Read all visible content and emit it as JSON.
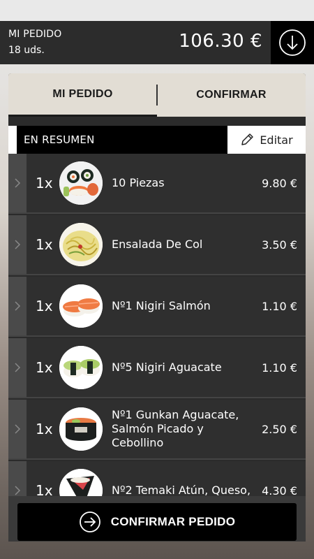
{
  "header": {
    "title": "MI PEDIDO",
    "count": "18 uds.",
    "total": "106.30 €",
    "download_icon": "arrow-down-circle-icon"
  },
  "tabs": [
    {
      "label": "MI PEDIDO",
      "active": true
    },
    {
      "label": "CONFIRMAR",
      "active": false
    }
  ],
  "summary": {
    "label": "EN RESUMEN",
    "edit_label": "Editar",
    "edit_icon": "pencil-icon"
  },
  "items": [
    {
      "qty": "1x",
      "name": "10 Piezas",
      "price": "9.80 €",
      "image": "sushi-platter"
    },
    {
      "qty": "1x",
      "name": "Ensalada De Col",
      "price": "3.50 €",
      "image": "cabbage-salad"
    },
    {
      "qty": "1x",
      "name": "Nº1 Nigiri Salmón",
      "price": "1.10 €",
      "image": "salmon-nigiri"
    },
    {
      "qty": "1x",
      "name": "Nº5 Nigiri Aguacate",
      "price": "1.10 €",
      "image": "avocado-nigiri"
    },
    {
      "qty": "1x",
      "name": "Nº1 Gunkan Aguacate, Salmón Picado y Cebollino",
      "price": "2.50 €",
      "image": "gunkan"
    },
    {
      "qty": "1x",
      "name": "Nº2 Temaki Atún, Queso,",
      "price": "4.30 €",
      "image": "temaki"
    }
  ],
  "confirm": {
    "label": "CONFIRMAR PEDIDO",
    "icon": "arrow-right-circle-icon"
  },
  "colors": {
    "header_bg": "#2c2c2c",
    "panel_bg": "#2b2b2b",
    "tab_bg": "#e2ddd4",
    "button_bg": "#000000"
  }
}
